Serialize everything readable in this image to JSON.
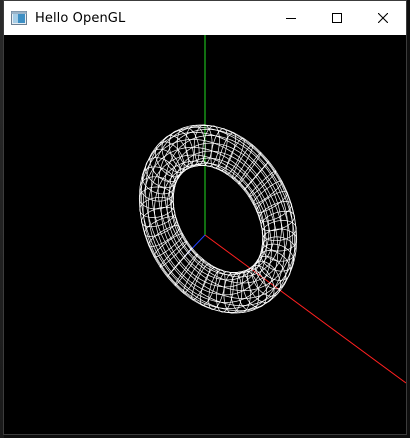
{
  "window": {
    "title": "Hello OpenGL",
    "icon": "opengl-app-icon",
    "controls": [
      "minimize-icon",
      "maximize-icon",
      "close-icon"
    ]
  },
  "scene": {
    "background": "#000000",
    "axes": {
      "x": "#ff2020",
      "y": "#22dd22",
      "z": "#2040ff"
    },
    "torus": {
      "render_mode": "wireframe",
      "color": "#ffffff"
    }
  }
}
